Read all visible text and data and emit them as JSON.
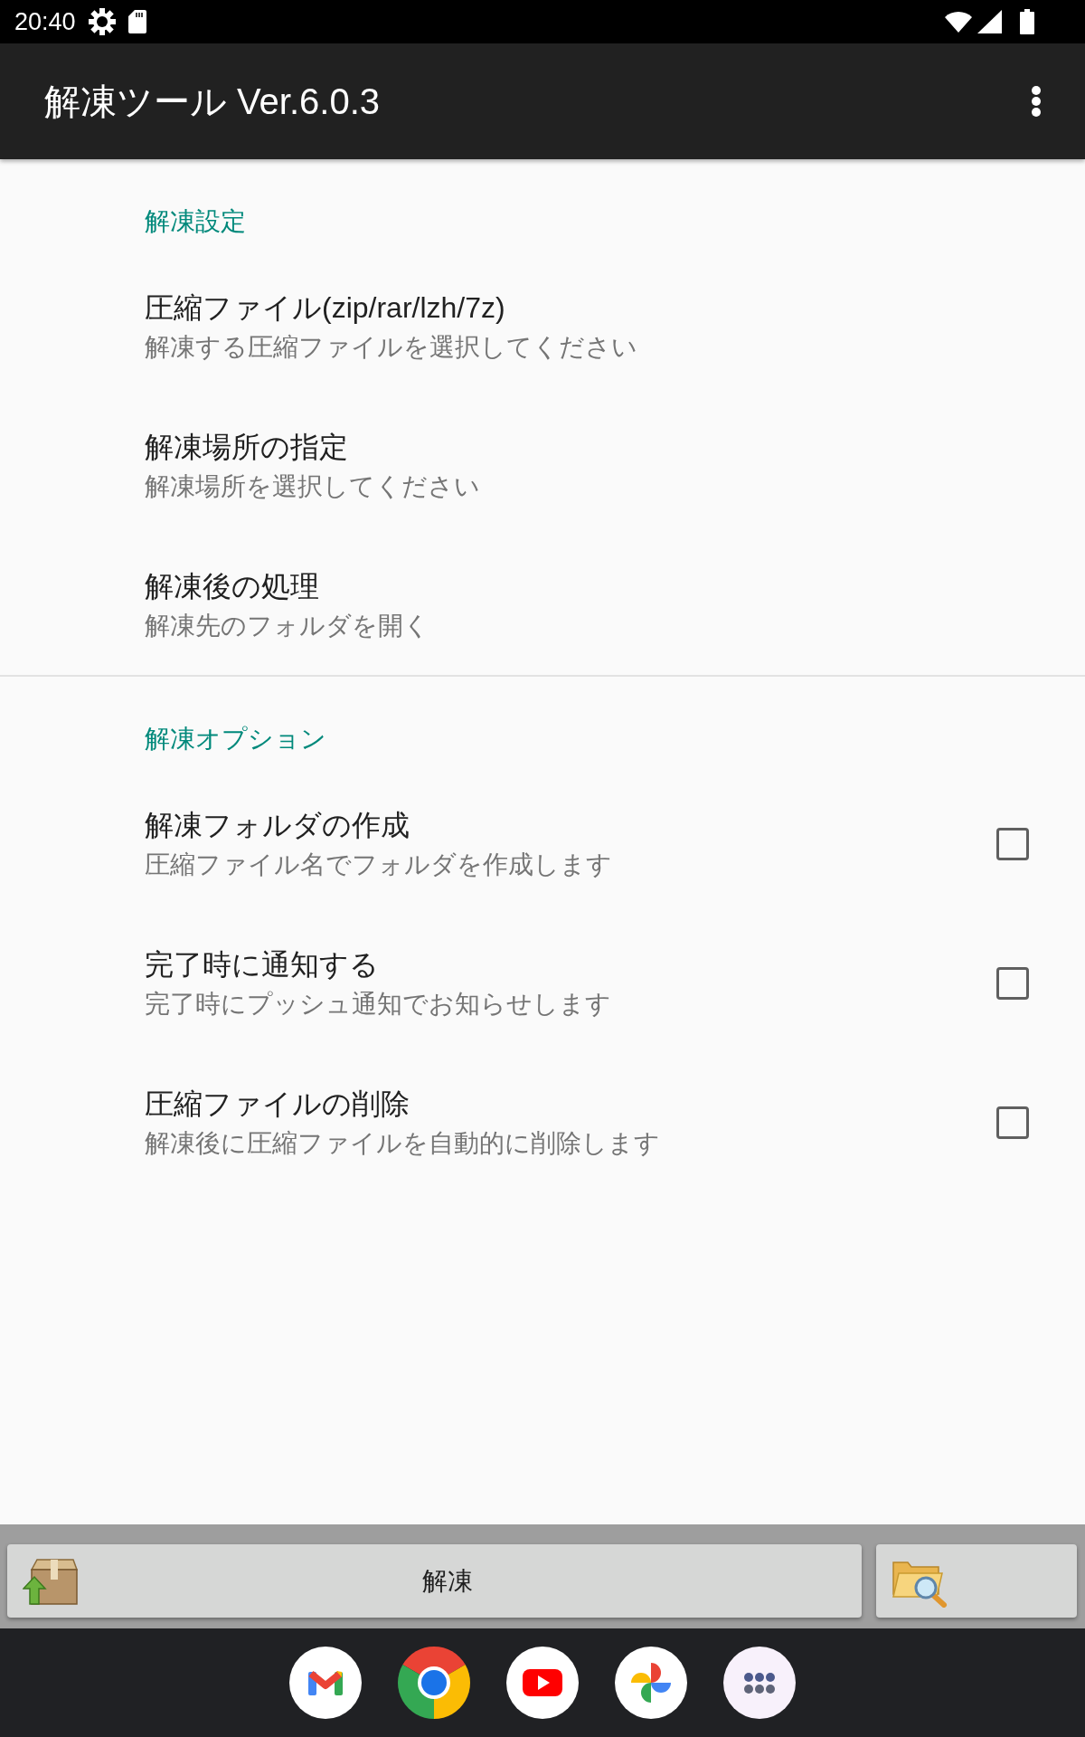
{
  "status_bar": {
    "time": "20:40"
  },
  "app_bar": {
    "title": "解凍ツール Ver.6.0.3"
  },
  "sections": [
    {
      "header": "解凍設定",
      "items": [
        {
          "kind": "plain",
          "title": "圧縮ファイル(zip/rar/lzh/7z)",
          "summary": "解凍する圧縮ファイルを選択してください"
        },
        {
          "kind": "plain",
          "title": "解凍場所の指定",
          "summary": "解凍場所を選択してください"
        },
        {
          "kind": "plain",
          "title": "解凍後の処理",
          "summary": "解凍先のフォルダを開く"
        }
      ]
    },
    {
      "header": "解凍オプション",
      "items": [
        {
          "kind": "checkbox",
          "title": "解凍フォルダの作成",
          "summary": "圧縮ファイル名でフォルダを作成します",
          "checked": false
        },
        {
          "kind": "checkbox",
          "title": "完了時に通知する",
          "summary": "完了時にプッシュ通知でお知らせします",
          "checked": false
        },
        {
          "kind": "checkbox",
          "title": "圧縮ファイルの削除",
          "summary": "解凍後に圧縮ファイルを自動的に削除します",
          "checked": false
        }
      ]
    }
  ],
  "action_bar": {
    "extract_label": "解凍"
  }
}
